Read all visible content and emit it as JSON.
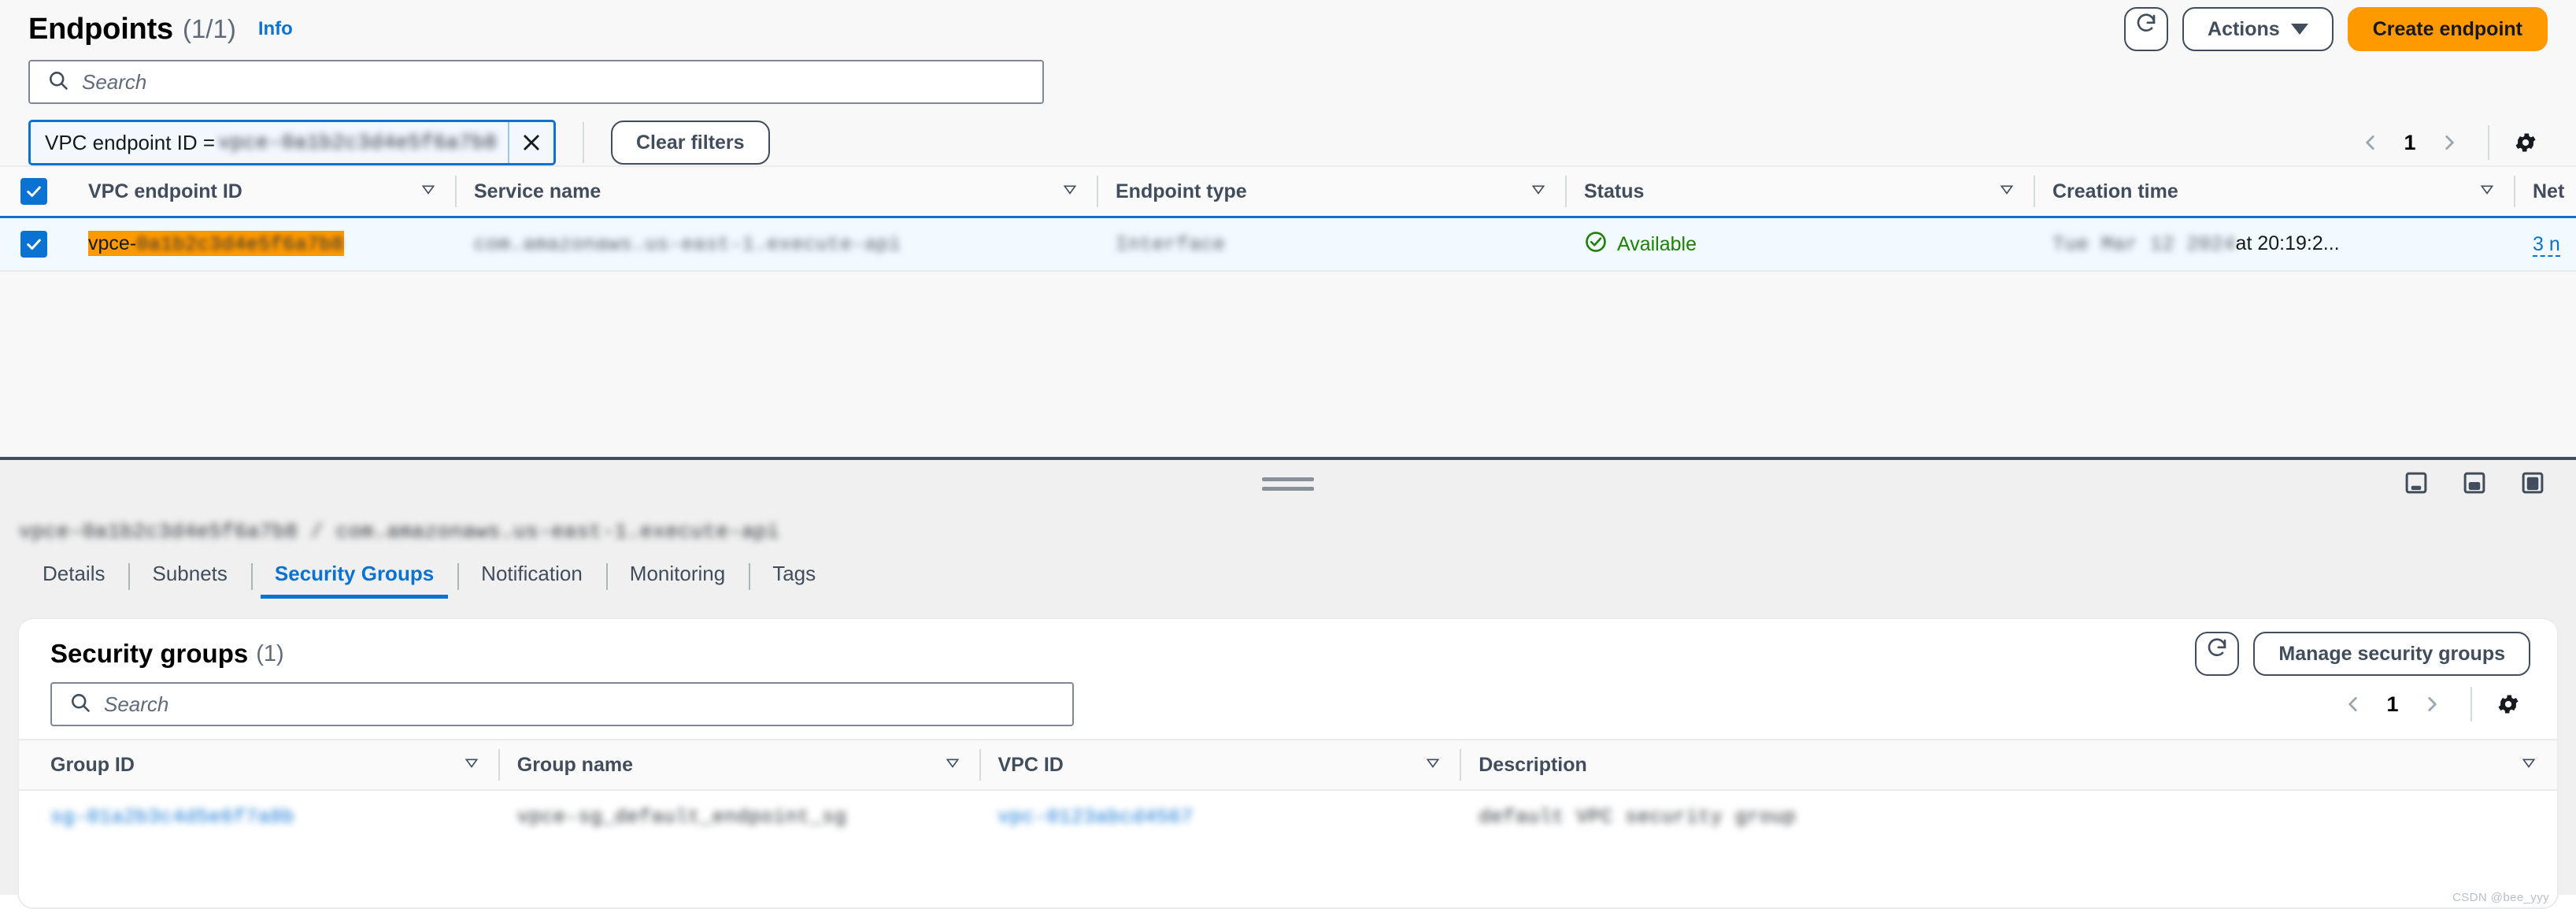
{
  "endpoints_panel": {
    "title": "Endpoints",
    "count": "(1/1)",
    "info_label": "Info",
    "refresh_icon": "refresh-icon",
    "actions_label": "Actions",
    "create_label": "Create endpoint",
    "search_placeholder": "Search",
    "filter_token_label": "VPC endpoint ID =",
    "filter_token_value": "vpce-0a1b2c3d4e5f6a7b8",
    "clear_filters_label": "Clear filters",
    "page_number": "1",
    "columns": [
      "VPC endpoint ID",
      "Service name",
      "Endpoint type",
      "Status",
      "Creation time",
      "Net"
    ],
    "rows": [
      {
        "selected": true,
        "vpc_endpoint_id_prefix": "vpce-",
        "vpc_endpoint_id_rest": "0a1b2c3d4e5f6a7b8",
        "service_name": "com.amazonaws.us-east-1.execute-api",
        "endpoint_type": "Interface",
        "status": "Available",
        "creation_time_prefix": "Tue Mar 12 2024",
        "creation_time_suffix": "at 20:19:2...",
        "network_interfaces": "3 n"
      }
    ]
  },
  "split_panel": {
    "resource_title": "vpce-0a1b2c3d4e5f6a7b8 / com.amazonaws.us-east-1.execute-api",
    "tabs": [
      {
        "label": "Details",
        "active": false
      },
      {
        "label": "Subnets",
        "active": false
      },
      {
        "label": "Security Groups",
        "active": true
      },
      {
        "label": "Notification",
        "active": false
      },
      {
        "label": "Monitoring",
        "active": false
      },
      {
        "label": "Tags",
        "active": false
      }
    ],
    "preset_icons": [
      "panel-small-icon",
      "panel-medium-icon",
      "panel-large-icon"
    ]
  },
  "security_groups": {
    "title": "Security groups",
    "count": "(1)",
    "refresh_icon": "refresh-icon",
    "manage_label": "Manage security groups",
    "search_placeholder": "Search",
    "page_number": "1",
    "columns": [
      "Group ID",
      "Group name",
      "VPC ID",
      "Description"
    ],
    "rows": [
      {
        "group_id": "sg-01a2b3c4d5e6f7a8b",
        "group_name": "vpce-sg_default_endpoint_sg",
        "vpc_id": "vpc-0123abcd4567",
        "description": "default VPC security group"
      }
    ]
  },
  "watermark": "CSDN @bee_yyy",
  "colors": {
    "accent_blue": "#0972d3",
    "primary_orange": "#ff9900",
    "status_green": "#1d8102",
    "selected_row_bg": "#f1faff",
    "panel_bg": "#f0f0f0"
  }
}
